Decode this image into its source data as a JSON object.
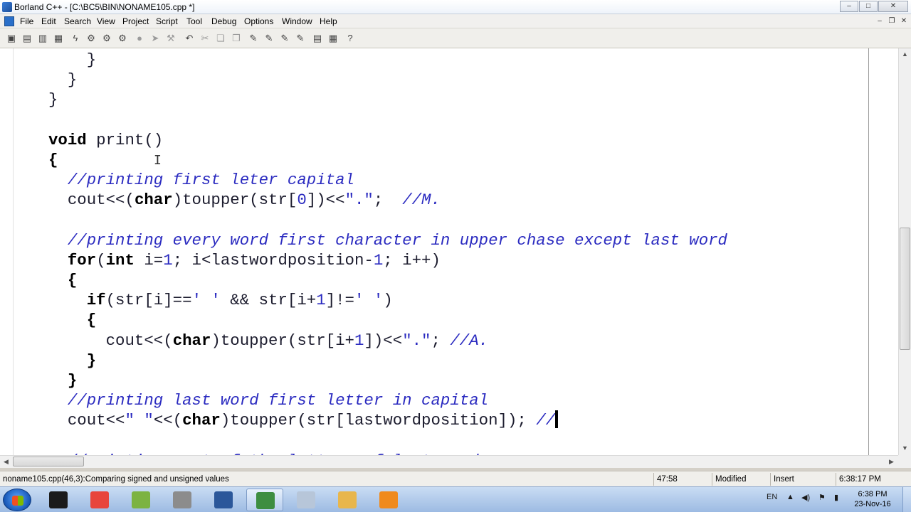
{
  "window": {
    "title": "Borland C++ - [C:\\BC5\\BIN\\NONAME105.cpp *]",
    "controls": [
      "–",
      "□",
      "✕"
    ]
  },
  "menu": {
    "items": [
      "File",
      "Edit",
      "Search",
      "View",
      "Project",
      "Script",
      "Tool",
      "Debug",
      "Options",
      "Window",
      "Help"
    ],
    "mdi_controls": [
      "–",
      "❐",
      "✕"
    ]
  },
  "toolbar": {
    "buttons": [
      {
        "icon": "project-icon",
        "glyph": "▣"
      },
      {
        "icon": "new-icon",
        "glyph": "▤"
      },
      {
        "icon": "open-icon",
        "glyph": "▥"
      },
      {
        "icon": "save-icon",
        "glyph": "▦"
      },
      {
        "icon": "lightning-icon",
        "glyph": "ϟ"
      },
      {
        "icon": "compile-icon",
        "glyph": "⚙"
      },
      {
        "icon": "make-icon",
        "glyph": "⚙"
      },
      {
        "icon": "build-icon",
        "glyph": "⚙"
      },
      {
        "icon": "stop-icon",
        "glyph": "●"
      },
      {
        "icon": "step-icon",
        "glyph": "➤"
      },
      {
        "icon": "debug-icon",
        "glyph": "⚒"
      },
      {
        "icon": "undo-icon",
        "glyph": "↶"
      },
      {
        "icon": "cut-icon",
        "glyph": "✂"
      },
      {
        "icon": "copy-icon",
        "glyph": "❏"
      },
      {
        "icon": "paste-icon",
        "glyph": "❐"
      },
      {
        "icon": "find-icon",
        "glyph": "✎"
      },
      {
        "icon": "find-next-icon",
        "glyph": "✎"
      },
      {
        "icon": "replace-icon",
        "glyph": "✎"
      },
      {
        "icon": "search-again-icon",
        "glyph": "✎"
      },
      {
        "icon": "browse-icon",
        "glyph": "▤"
      },
      {
        "icon": "message-icon",
        "glyph": "▦"
      },
      {
        "icon": "help-icon",
        "glyph": "?"
      }
    ]
  },
  "editor": {
    "lines": [
      {
        "indent": 4,
        "tokens": [
          {
            "t": "}",
            "k": "pl"
          }
        ]
      },
      {
        "indent": 2,
        "tokens": [
          {
            "t": "}",
            "k": "pl"
          }
        ]
      },
      {
        "indent": 0,
        "tokens": [
          {
            "t": "}",
            "k": "pl"
          }
        ]
      },
      {
        "indent": 0,
        "tokens": []
      },
      {
        "indent": 0,
        "tokens": [
          {
            "t": "void",
            "k": "kw"
          },
          {
            "t": " print()",
            "k": "pl"
          }
        ]
      },
      {
        "indent": 0,
        "tokens": [
          {
            "t": "{",
            "k": "kw"
          }
        ]
      },
      {
        "indent": 2,
        "tokens": [
          {
            "t": "//printing first leter capital",
            "k": "cm"
          }
        ]
      },
      {
        "indent": 2,
        "tokens": [
          {
            "t": "cout<<(",
            "k": "pl"
          },
          {
            "t": "char",
            "k": "kw"
          },
          {
            "t": ")toupper(str[",
            "k": "pl"
          },
          {
            "t": "0",
            "k": "num"
          },
          {
            "t": "])<<",
            "k": "pl"
          },
          {
            "t": "\".\"",
            "k": "str"
          },
          {
            "t": ";  ",
            "k": "pl"
          },
          {
            "t": "//M.",
            "k": "cm"
          }
        ]
      },
      {
        "indent": 0,
        "tokens": []
      },
      {
        "indent": 2,
        "tokens": [
          {
            "t": "//printing every word first character in upper chase except last word",
            "k": "cm"
          }
        ]
      },
      {
        "indent": 2,
        "tokens": [
          {
            "t": "for",
            "k": "kw"
          },
          {
            "t": "(",
            "k": "pl"
          },
          {
            "t": "int",
            "k": "kw"
          },
          {
            "t": " i=",
            "k": "pl"
          },
          {
            "t": "1",
            "k": "num"
          },
          {
            "t": "; i<lastwordposition-",
            "k": "pl"
          },
          {
            "t": "1",
            "k": "num"
          },
          {
            "t": "; i++)",
            "k": "pl"
          }
        ]
      },
      {
        "indent": 2,
        "tokens": [
          {
            "t": "{",
            "k": "kw"
          }
        ]
      },
      {
        "indent": 4,
        "tokens": [
          {
            "t": "if",
            "k": "kw"
          },
          {
            "t": "(str[i]==",
            "k": "pl"
          },
          {
            "t": "' '",
            "k": "str"
          },
          {
            "t": " && str[i+",
            "k": "pl"
          },
          {
            "t": "1",
            "k": "num"
          },
          {
            "t": "]!=",
            "k": "pl"
          },
          {
            "t": "' '",
            "k": "str"
          },
          {
            "t": ")",
            "k": "pl"
          }
        ]
      },
      {
        "indent": 4,
        "tokens": [
          {
            "t": "{",
            "k": "kw"
          }
        ]
      },
      {
        "indent": 6,
        "tokens": [
          {
            "t": "cout<<(",
            "k": "pl"
          },
          {
            "t": "char",
            "k": "kw"
          },
          {
            "t": ")toupper(str[i+",
            "k": "pl"
          },
          {
            "t": "1",
            "k": "num"
          },
          {
            "t": "])<<",
            "k": "pl"
          },
          {
            "t": "\".\"",
            "k": "str"
          },
          {
            "t": "; ",
            "k": "pl"
          },
          {
            "t": "//A.",
            "k": "cm"
          }
        ]
      },
      {
        "indent": 4,
        "tokens": [
          {
            "t": "}",
            "k": "kw"
          }
        ]
      },
      {
        "indent": 2,
        "tokens": [
          {
            "t": "}",
            "k": "kw"
          }
        ]
      },
      {
        "indent": 2,
        "tokens": [
          {
            "t": "//printing last word first letter in capital",
            "k": "cm"
          }
        ]
      },
      {
        "indent": 2,
        "tokens": [
          {
            "t": "cout<<",
            "k": "pl"
          },
          {
            "t": "\" \"",
            "k": "str"
          },
          {
            "t": "<<(",
            "k": "pl"
          },
          {
            "t": "char",
            "k": "kw"
          },
          {
            "t": ")toupper(str[lastwordposition]); ",
            "k": "pl"
          },
          {
            "t": "//",
            "k": "cm"
          }
        ],
        "caret": true
      },
      {
        "indent": 0,
        "tokens": []
      },
      {
        "indent": 2,
        "tokens": [
          {
            "t": "//printing rest of the letters of last word",
            "k": "cm"
          }
        ]
      }
    ]
  },
  "status": {
    "message": "noname105.cpp(46,3):Comparing signed and unsigned values",
    "position": "47:58",
    "modified": "Modified",
    "mode": "Insert",
    "time": "6:38:17 PM"
  },
  "taskbar": {
    "apps": [
      {
        "icon": "console-icon",
        "color": "#1b1b1b",
        "active": false
      },
      {
        "icon": "chrome-icon",
        "color": "#e8453c",
        "active": false
      },
      {
        "icon": "notepad-icon",
        "color": "#7cb342",
        "active": false
      },
      {
        "icon": "printer-icon",
        "color": "#8c8c8c",
        "active": false
      },
      {
        "icon": "word-icon",
        "color": "#2b579a",
        "active": false
      },
      {
        "icon": "borland-icon",
        "color": "#3e8e41",
        "active": true
      },
      {
        "icon": "calculator-icon",
        "color": "#b7c6d9",
        "active": false
      },
      {
        "icon": "explorer-icon",
        "color": "#e8b64c",
        "active": false
      },
      {
        "icon": "vlc-icon",
        "color": "#f08a1c",
        "active": false
      }
    ],
    "tray": {
      "lang": "EN",
      "clock_time": "6:38 PM",
      "clock_date": "23-Nov-16"
    }
  }
}
